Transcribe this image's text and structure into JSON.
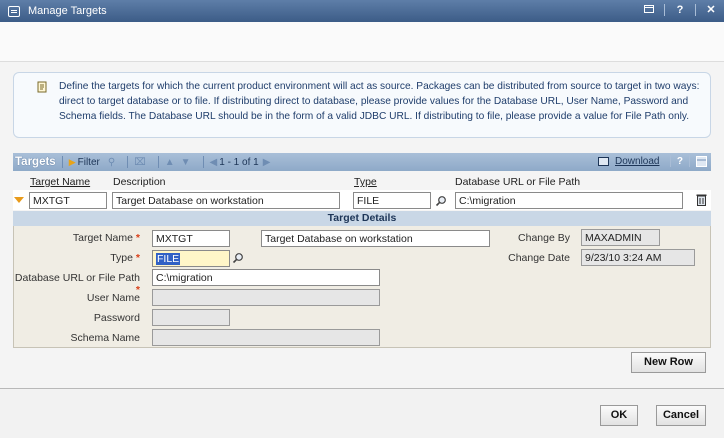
{
  "window": {
    "title": "Manage Targets",
    "controls": [
      "minimize-icon",
      "help-icon",
      "close-icon"
    ]
  },
  "help": {
    "text": "Define the targets for which the current product environment will act as source. Packages can be distributed from source to target in two ways: direct to target database or to file. If distributing direct to database, please provide values for the Database URL, User Name, Password and Schema fields. The Database URL should be in the form of a valid JDBC URL. If distributing to file, please provide a value for File Path only."
  },
  "table": {
    "title": "Targets",
    "filter_label": "Filter",
    "pagination": "1 - 1 of 1",
    "download_label": "Download",
    "columns": {
      "target_name": "Target Name",
      "description": "Description",
      "type": "Type",
      "url": "Database URL or File Path"
    },
    "row": {
      "target_name": "MXTGT",
      "description": "Target Database on workstation",
      "type": "FILE",
      "url": "C:\\migration"
    }
  },
  "details": {
    "header": "Target Details",
    "target_name_label": "Target Name",
    "target_name": "MXTGT",
    "description": "Target Database on workstation",
    "type_label": "Type",
    "type": "FILE",
    "url_label": "Database URL or File Path",
    "url": "C:\\migration",
    "user_name_label": "User Name",
    "password_label": "Password",
    "schema_label": "Schema Name",
    "change_by_label": "Change By",
    "change_by": "MAXADMIN",
    "change_date_label": "Change Date",
    "change_date": "9/23/10 3:24 AM"
  },
  "buttons": {
    "new_row": "New Row",
    "ok": "OK",
    "cancel": "Cancel"
  },
  "colors": {
    "titlebar": "#3c5c87",
    "required": "#d9401a",
    "accent_arrow": "#e89b1c"
  }
}
